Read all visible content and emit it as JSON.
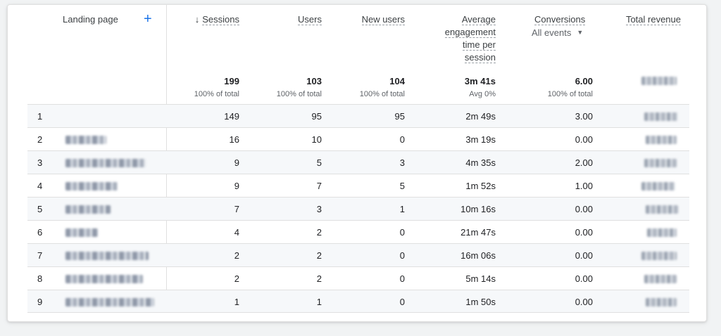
{
  "table": {
    "dimension_label": "Landing page",
    "columns": [
      {
        "label": "Sessions",
        "sort": "descending",
        "total": "199",
        "total_sub": "100% of total"
      },
      {
        "label": "Users",
        "total": "103",
        "total_sub": "100% of total"
      },
      {
        "label": "New users",
        "total": "104",
        "total_sub": "100% of total"
      },
      {
        "label_lines": [
          "Average",
          "engagement",
          "time per",
          "session"
        ],
        "total": "3m 41s",
        "total_sub": "Avg 0%"
      },
      {
        "label": "Conversions",
        "filter": "All events",
        "total": "6.00",
        "total_sub": "100% of total"
      },
      {
        "label": "Total revenue",
        "total_redacted": true
      }
    ],
    "rows": [
      {
        "idx": "1",
        "sessions": "149",
        "users": "95",
        "new_users": "95",
        "avg_time": "2m 49s",
        "conversions": "3.00"
      },
      {
        "idx": "2",
        "sessions": "16",
        "users": "10",
        "new_users": "0",
        "avg_time": "3m 19s",
        "conversions": "0.00"
      },
      {
        "idx": "3",
        "sessions": "9",
        "users": "5",
        "new_users": "3",
        "avg_time": "4m 35s",
        "conversions": "2.00"
      },
      {
        "idx": "4",
        "sessions": "9",
        "users": "7",
        "new_users": "5",
        "avg_time": "1m 52s",
        "conversions": "1.00"
      },
      {
        "idx": "5",
        "sessions": "7",
        "users": "3",
        "new_users": "1",
        "avg_time": "10m 16s",
        "conversions": "0.00"
      },
      {
        "idx": "6",
        "sessions": "4",
        "users": "2",
        "new_users": "0",
        "avg_time": "21m 47s",
        "conversions": "0.00"
      },
      {
        "idx": "7",
        "sessions": "2",
        "users": "2",
        "new_users": "0",
        "avg_time": "16m 06s",
        "conversions": "0.00"
      },
      {
        "idx": "8",
        "sessions": "2",
        "users": "2",
        "new_users": "0",
        "avg_time": "5m 14s",
        "conversions": "0.00"
      },
      {
        "idx": "9",
        "sessions": "1",
        "users": "1",
        "new_users": "0",
        "avg_time": "1m 50s",
        "conversions": "0.00"
      }
    ]
  },
  "icons": {
    "add": "plus-icon",
    "sort": "arrow-down-icon",
    "dropdown": "caret-down-icon"
  },
  "colors": {
    "accent": "#1a73e8",
    "row_shade": "#f6f8fa",
    "border": "#e0e0e0"
  }
}
